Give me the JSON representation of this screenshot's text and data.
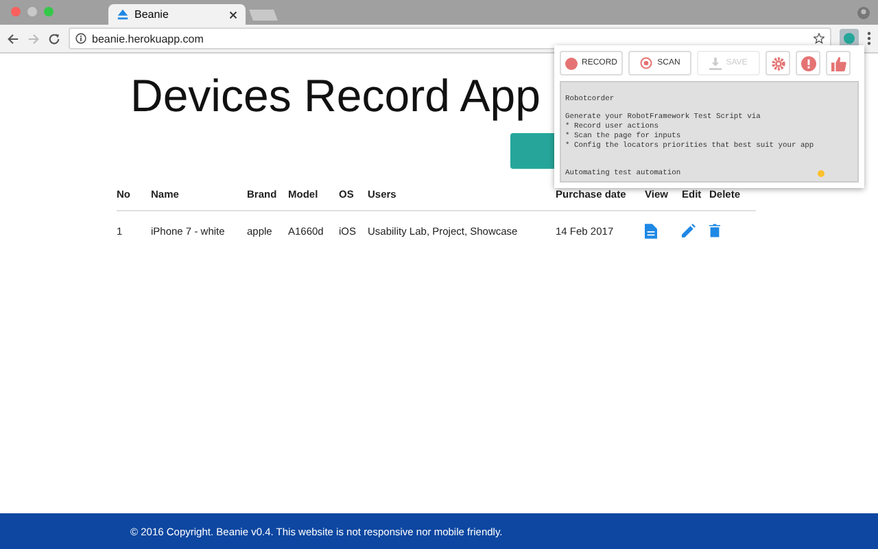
{
  "browser": {
    "tab_title": "Beanie",
    "url": "beanie.herokuapp.com"
  },
  "page": {
    "title": "Devices Record App"
  },
  "table": {
    "columns": [
      "No",
      "Name",
      "Brand",
      "Model",
      "OS",
      "Users",
      "Purchase date",
      "View",
      "Edit",
      "Delete"
    ],
    "rows": [
      {
        "cells": [
          "1",
          "iPhone 7 - white",
          "apple",
          "A1660d",
          "iOS",
          "Usability Lab, Project, Showcase",
          "14 Feb 2017"
        ]
      }
    ]
  },
  "footer": {
    "text": "© 2016 Copyright. Beanie v0.4. This website is not responsive nor mobile friendly."
  },
  "extension_popup": {
    "buttons": [
      {
        "kind": "record",
        "label": "RECORD",
        "disabled": false
      },
      {
        "kind": "scan",
        "label": "SCAN",
        "disabled": false
      },
      {
        "kind": "save",
        "label": "SAVE",
        "disabled": true
      }
    ],
    "script_text": "Robotcorder\n\nGenerate your RobotFramework Test Script via\n* Record user actions\n* Scan the page for inputs\n* Config the locators priorities that best suit your app\n\n\nAutomating test automation"
  }
}
